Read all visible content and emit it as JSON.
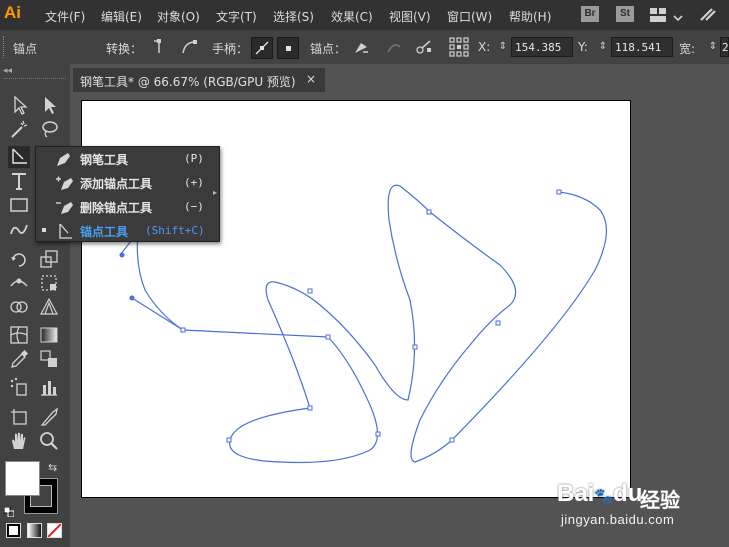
{
  "app": {
    "logo": "Ai"
  },
  "menu": [
    "文件(F)",
    "编辑(E)",
    "对象(O)",
    "文字(T)",
    "选择(S)",
    "效果(C)",
    "视图(V)",
    "窗口(W)",
    "帮助(H)"
  ],
  "top_buttons": {
    "bridge": "Br",
    "stock": "St",
    "workspace_icon": "grid-icon",
    "workspace_chevron": "chevron-down-icon",
    "search_icon": "flame-icon"
  },
  "control_bar": {
    "selection_label": "锚点",
    "convert_label": "转换：",
    "handles_label": "手柄：",
    "anchors_label": "锚点：",
    "x_label": "X:",
    "x_value": "154.385 m",
    "y_label": "Y:",
    "y_value": "118.541 m",
    "width_label": "宽:",
    "width_value": "2"
  },
  "document_tab": {
    "title": "钢笔工具* @ 66.67% (RGB/GPU 预览)",
    "close": "×"
  },
  "flyout": {
    "items": [
      {
        "label": "钢笔工具",
        "shortcut": "(P)",
        "icon": "pen-icon",
        "active": false
      },
      {
        "label": "添加锚点工具",
        "shortcut": "(+)",
        "icon": "add-anchor-icon",
        "active": false
      },
      {
        "label": "删除锚点工具",
        "shortcut": "(−)",
        "icon": "delete-anchor-icon",
        "active": false
      },
      {
        "label": "锚点工具",
        "shortcut": "(Shift+C)",
        "icon": "anchor-point-icon",
        "active": true
      }
    ]
  },
  "colors": {
    "path": "#4a6fd8",
    "active_menu": "#4a9df0",
    "logo": "#ff9a00"
  },
  "watermark": {
    "brand": "Bai",
    "brand_suffix": "du",
    "cn": "经验",
    "url": "jingyan.baidu.com"
  }
}
